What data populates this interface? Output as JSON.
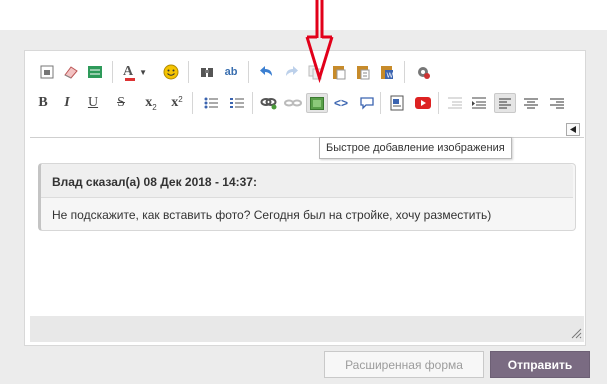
{
  "tooltip": {
    "text": "Быстрое добавление изображения"
  },
  "quote": {
    "author_line": "Влад сказал(а) 08 Дек 2018 - 14:37:",
    "body": "Не подскажите, как вставить фото? Сегодня был на стройке, хочу разместить)"
  },
  "buttons": {
    "advanced_label": "Расширенная форма",
    "send_label": "Отправить"
  },
  "toolbar": {
    "row1": [
      "paste-as-text-icon",
      "eraser-icon",
      "source-icon",
      "font-color-icon",
      "smiley-icon",
      "binoculars-icon",
      "spellcheck-icon",
      "undo-icon",
      "redo-icon",
      "copy-icon",
      "paste-icon",
      "paste-text-icon",
      "paste-word-icon",
      "settings-icon"
    ],
    "row2": [
      "bold",
      "italic",
      "underline",
      "strikethrough",
      "subscript",
      "superscript",
      "bulleted-list",
      "numbered-list",
      "link-icon",
      "unlink-icon",
      "image-icon",
      "code-icon",
      "quote-icon",
      "media-icon",
      "youtube-icon",
      "outdent-icon",
      "indent-icon",
      "align-left-icon",
      "align-center-icon",
      "align-right-icon"
    ],
    "glyphs": {
      "bold": "B",
      "italic": "I",
      "underline": "U",
      "strike": "S",
      "sub": "x",
      "sub_mark": "2",
      "sup": "x",
      "sup_mark": "2"
    }
  },
  "colors": {
    "panel_bg": "#ececec",
    "send_bg": "#7a6b82",
    "arrow": "#e2001a"
  }
}
